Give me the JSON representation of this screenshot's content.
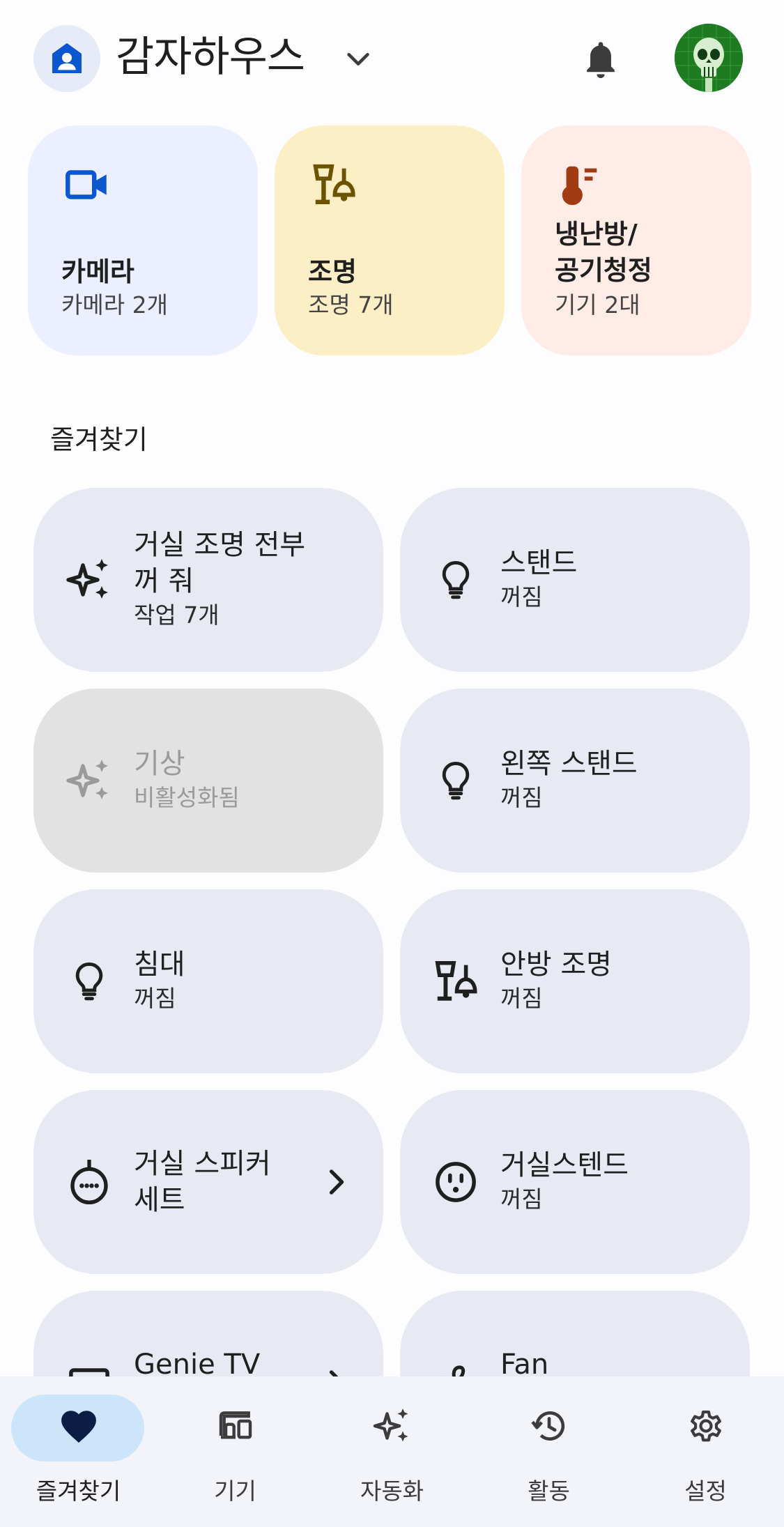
{
  "header": {
    "home_name": "감자하우스",
    "icons": [
      "home-person-icon",
      "chevron-down-icon",
      "bell-icon",
      "avatar-skull"
    ]
  },
  "categories": [
    {
      "title": "카메라",
      "subtitle": "카메라 2개",
      "icon": "videocam-icon",
      "bg": "#ebefff",
      "icon_color": "#0b57d0"
    },
    {
      "title": "조명",
      "subtitle": "조명 7개",
      "icon": "lamp-icon",
      "bg": "#fdefc5",
      "icon_color": "#6b5300"
    },
    {
      "title_line1": "냉난방/",
      "title_line2": "공기청정",
      "subtitle": "기기 2대",
      "icon": "thermostat-icon",
      "bg": "#ffece6",
      "icon_color": "#a23a12"
    }
  ],
  "favorites": {
    "section_title": "즐겨찾기",
    "items": [
      {
        "title_line1": "거실 조명 전부",
        "title_line2": "꺼 줘",
        "subtitle": "작업 7개",
        "icon": "sparkle-icon"
      },
      {
        "title": "스탠드",
        "subtitle": "꺼짐",
        "icon": "bulb-icon"
      },
      {
        "title": "기상",
        "subtitle": "비활성화됨",
        "icon": "sparkle-icon",
        "disabled": true
      },
      {
        "title": "왼쪽 스탠드",
        "subtitle": "꺼짐",
        "icon": "bulb-icon"
      },
      {
        "title": "침대",
        "subtitle": "꺼짐",
        "icon": "bulb-icon"
      },
      {
        "title": "안방 조명",
        "subtitle": "꺼짐",
        "icon": "lamp-icon"
      },
      {
        "title_line1": "거실 스피커",
        "title_line2": "세트",
        "icon": "speaker-icon",
        "has_arrow": true
      },
      {
        "title": "거실스텐드",
        "subtitle": "꺼짐",
        "icon": "outlet-icon"
      },
      {
        "title": "Genie TV",
        "icon": "tv-icon",
        "has_arrow": true
      },
      {
        "title": "Fan",
        "icon": "fan-icon"
      }
    ]
  },
  "nav": {
    "items": [
      {
        "label": "즐겨찾기",
        "icon": "heart-icon",
        "active": true
      },
      {
        "label": "기기",
        "icon": "devices-icon"
      },
      {
        "label": "자동화",
        "icon": "sparkle-icon"
      },
      {
        "label": "활동",
        "icon": "history-icon"
      },
      {
        "label": "설정",
        "icon": "gear-icon"
      }
    ]
  },
  "colors": {
    "card_bg": "#e7eaf3",
    "disabled_bg": "#e2e2e2",
    "nav_active_pill": "#cde5fb",
    "heart": "#0b1d44"
  }
}
